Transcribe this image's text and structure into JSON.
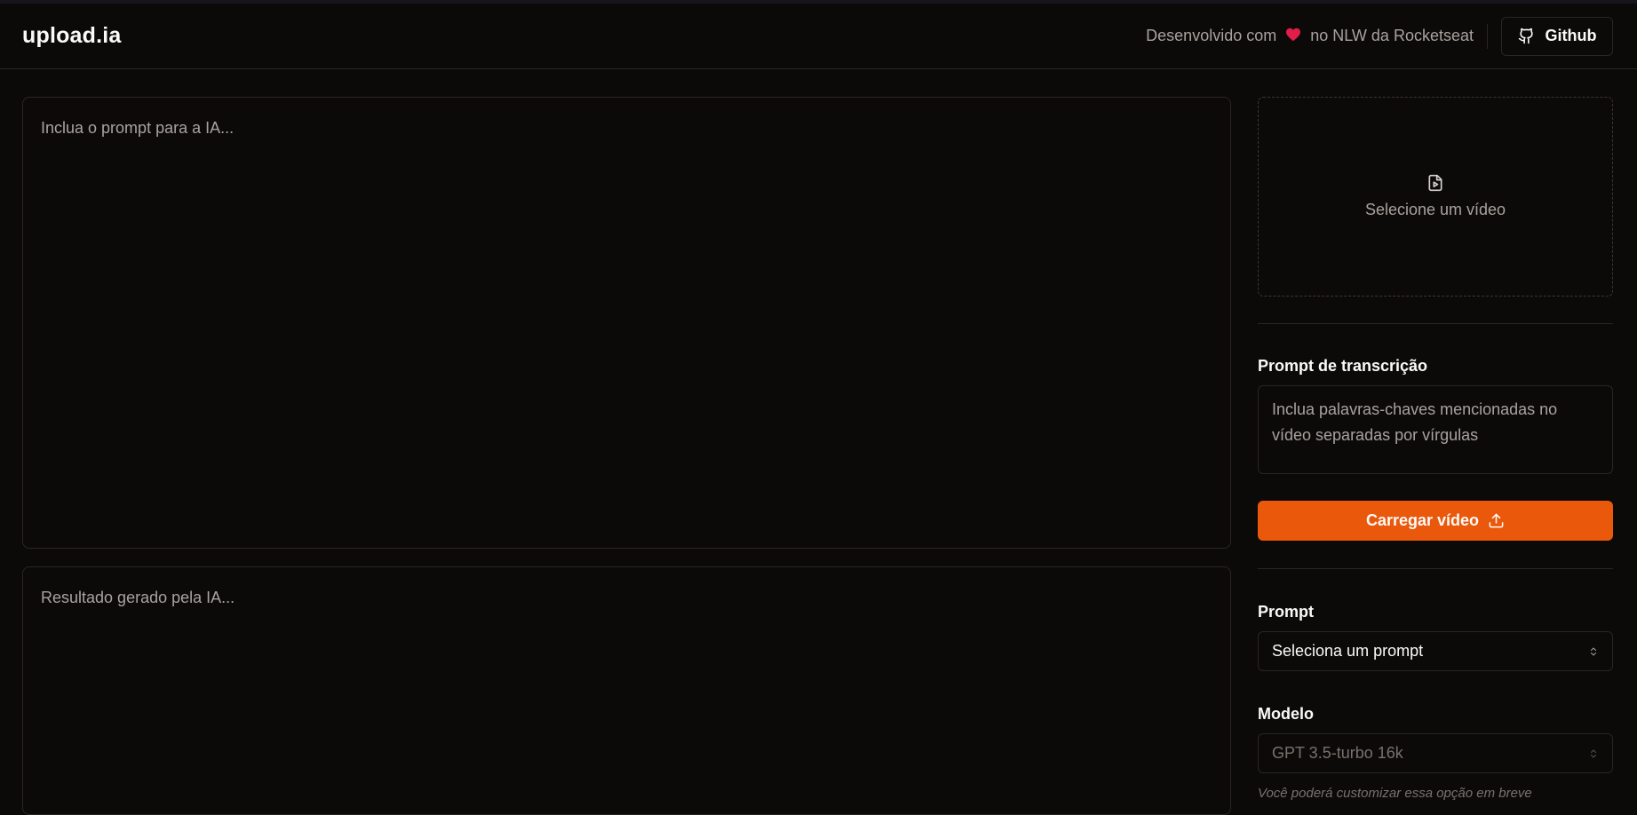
{
  "header": {
    "logo": "upload.ia",
    "credit_before": "Desenvolvido com",
    "credit_after": "no NLW da Rocketseat",
    "heart_icon": "heart-icon",
    "github_label": "Github"
  },
  "editor": {
    "prompt_placeholder": "Inclua o prompt para a IA...",
    "result_placeholder": "Resultado gerado pela IA..."
  },
  "sidebar": {
    "video_dropzone_label": "Selecione um vídeo",
    "transcription_label": "Prompt de transcrição",
    "transcription_placeholder": "Inclua palavras-chaves mencionadas no vídeo separadas por vírgulas",
    "upload_button_label": "Carregar vídeo",
    "prompt_label": "Prompt",
    "prompt_select_value": "Seleciona um prompt",
    "model_label": "Modelo",
    "model_select_value": "GPT 3.5-turbo 16k",
    "model_hint": "Você poderá customizar essa opção em breve"
  },
  "colors": {
    "background": "#0c0a09",
    "border": "#292524",
    "accent": "#ea580c",
    "muted_text": "#a8a29e",
    "heart": "#e11d48"
  }
}
